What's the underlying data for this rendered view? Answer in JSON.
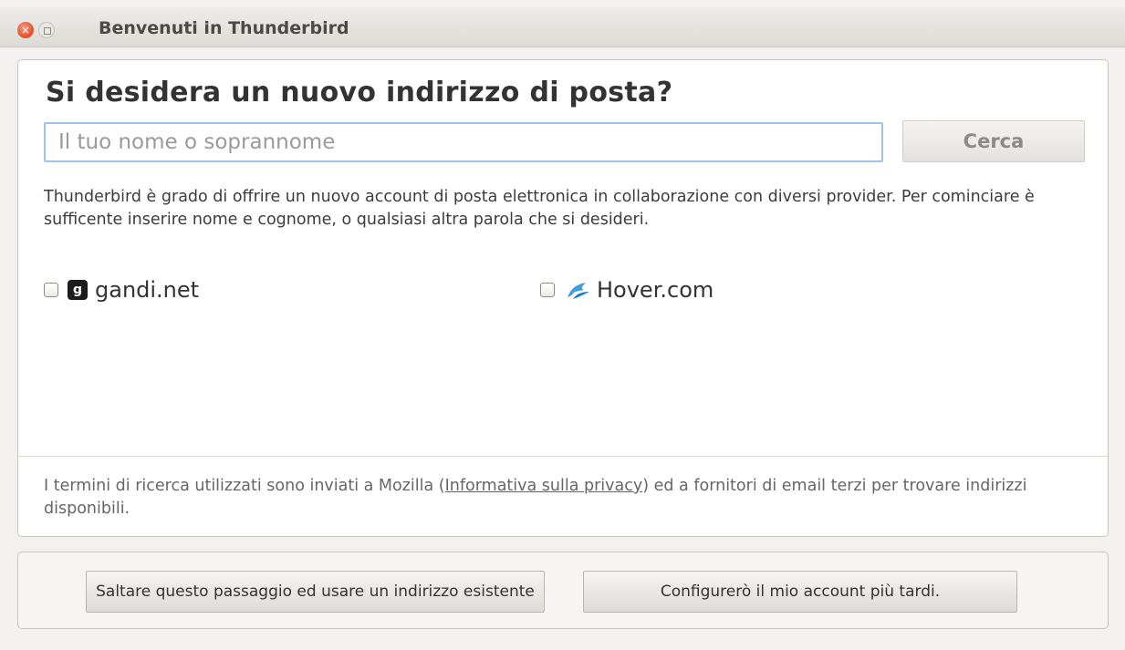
{
  "window": {
    "title": "Benvenuti in Thunderbird",
    "close_glyph": "×"
  },
  "main": {
    "heading": "Si desidera un nuovo indirizzo di posta?",
    "search": {
      "placeholder": "Il tuo nome o soprannome",
      "value": "",
      "button_label": "Cerca"
    },
    "description": "Thunderbird è grado di offrire un nuovo account di posta elettronica in collaborazione con diversi provider. Per cominciare è sufficente inserire nome e cognome, o qualsiasi altra parola che si desideri.",
    "providers": [
      {
        "name": "gandi.net",
        "checked": false,
        "icon": "gandi-logo-icon",
        "logo_glyph": "g"
      },
      {
        "name": "Hover.com",
        "checked": false,
        "icon": "hover-logo-icon"
      }
    ],
    "privacy": {
      "text_before": "I termini di ricerca utilizzati sono inviati a Mozilla (",
      "link_label": "Informativa sulla privacy",
      "text_after": ") ed a fornitori di email terzi per trovare indirizzi disponibili."
    }
  },
  "footer": {
    "skip_label": "Saltare questo passaggio ed usare un indirizzo esistente",
    "later_label": "Configurerò il mio account più tardi."
  },
  "colors": {
    "close_button": "#e2572f",
    "input_focus_border": "#9fc4e8",
    "hover_logo": "#3a9fe0"
  }
}
